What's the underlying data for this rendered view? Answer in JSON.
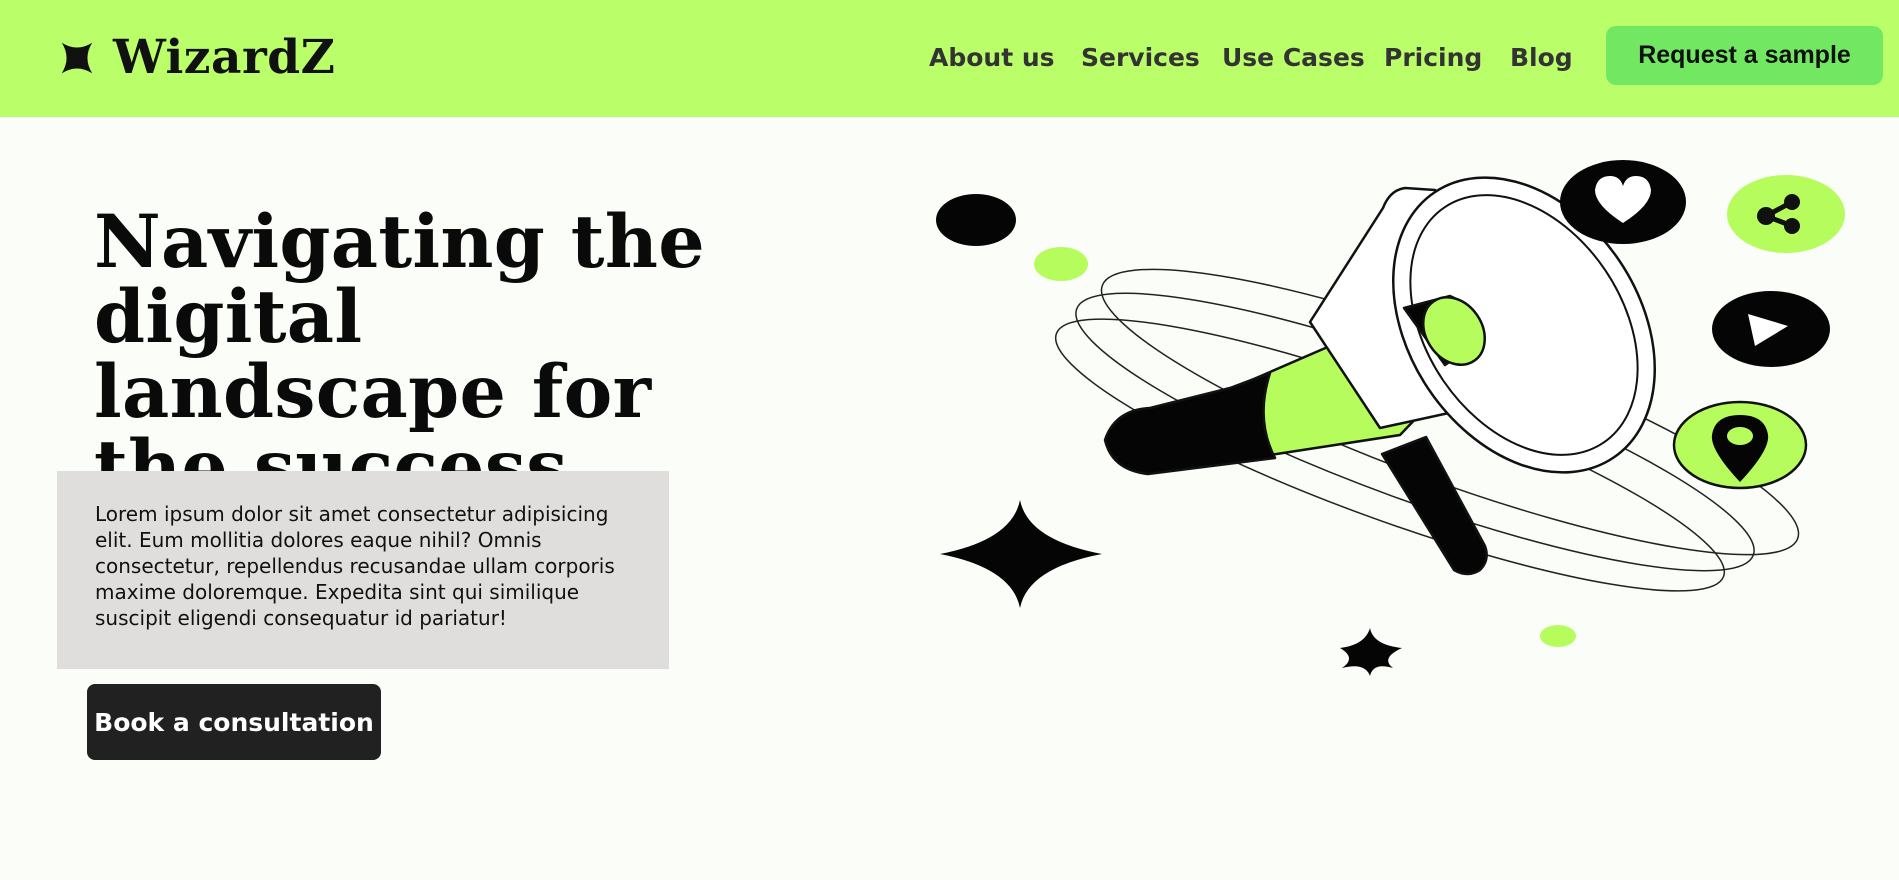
{
  "header": {
    "logo_icon": "four-point-star-icon",
    "logo_text": "WizardZ",
    "nav": [
      {
        "label": "About us"
      },
      {
        "label": "Services"
      },
      {
        "label": "Use Cases"
      },
      {
        "label": "Pricing"
      },
      {
        "label": "Blog"
      }
    ],
    "cta_label": "Request a sample"
  },
  "hero": {
    "title": "Navigating the digital landscape for the success",
    "description": "Lorem ipsum dolor sit amet consectetur adipisicing elit. Eum mollitia dolores eaque nihil? Omnis consectetur, repellendus recusandae ullam corporis maxime doloremque. Expedita sint qui similique suscipit eligendi consequatur id pariatur!",
    "button_label": "Book a consultation"
  },
  "illustration": {
    "main": "megaphone-icon",
    "icons": [
      "heart-icon",
      "share-icon",
      "play-icon",
      "location-pin-icon",
      "sparkle-icon"
    ]
  },
  "colors": {
    "header_bg": "#bafe69",
    "accent_green": "#b6fc5d",
    "cta_green": "#72e862",
    "dark": "#212121",
    "desc_bg": "#e0dddd",
    "page_bg": "#fbfdf9"
  }
}
